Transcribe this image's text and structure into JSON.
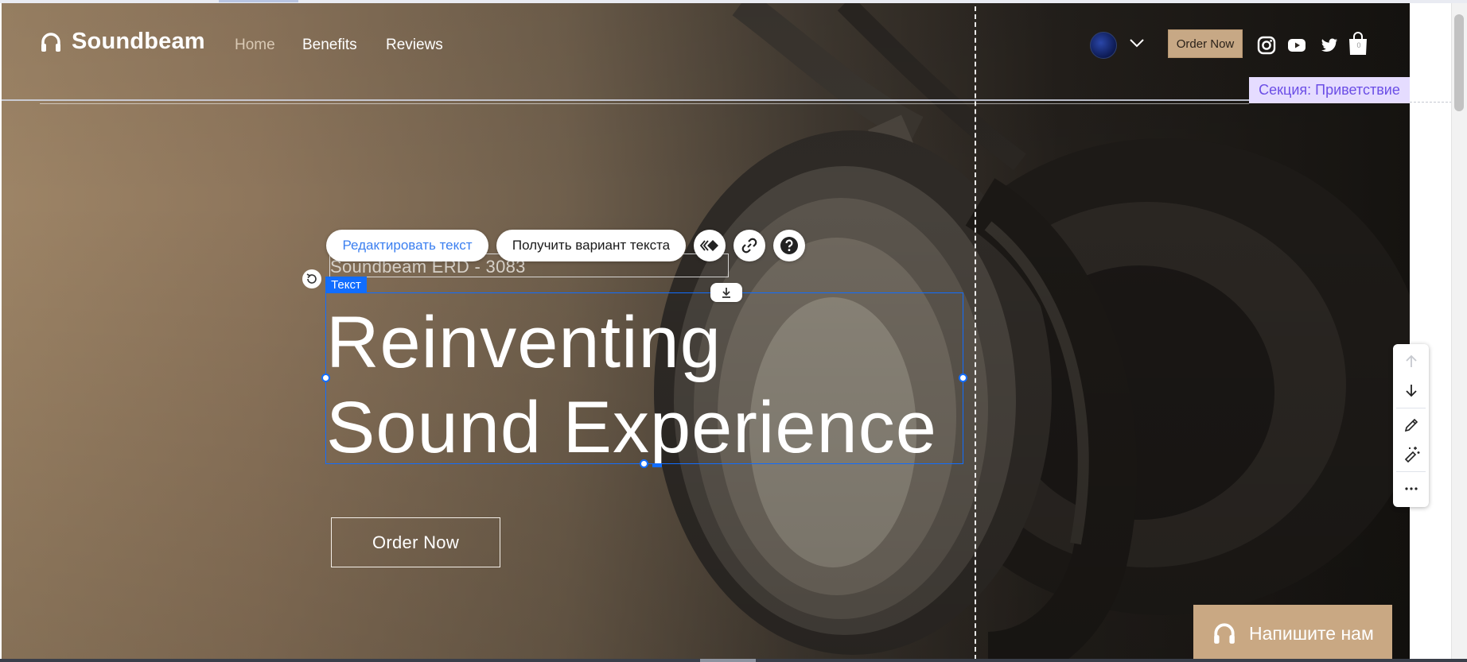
{
  "brand": {
    "name": "Soundbeam"
  },
  "nav": {
    "items": [
      "Home",
      "Benefits",
      "Reviews"
    ]
  },
  "header": {
    "order_button": "Order Now",
    "cart_count": "0"
  },
  "editor": {
    "section_label": "Секция: Приветствие",
    "toolbar": {
      "edit_text": "Редактировать текст",
      "get_variant": "Получить вариант текста"
    },
    "selection_tag": "Текст"
  },
  "hero": {
    "subtitle": "Soundbeam ERD - 3083",
    "headline_line1": "Reinventing",
    "headline_line2": "Sound Experience",
    "cta": "Order Now"
  },
  "chat": {
    "label": "Напишите нам"
  },
  "colors": {
    "accent_tan": "#c9a883",
    "selection_blue": "#116dff",
    "section_tag_bg": "#e5dcff",
    "section_tag_text": "#6b4ee6",
    "link_blue": "#3b7ff0"
  },
  "icons": [
    "headphones-icon",
    "globe-icon",
    "chevron-down-icon",
    "instagram-icon",
    "youtube-icon",
    "twitter-icon",
    "shopping-bag-icon",
    "animation-icon",
    "link-icon",
    "help-icon",
    "rotate-icon",
    "anchor-icon",
    "arrow-up-icon",
    "arrow-down-icon",
    "pen-icon",
    "magic-wand-icon",
    "more-icon"
  ]
}
